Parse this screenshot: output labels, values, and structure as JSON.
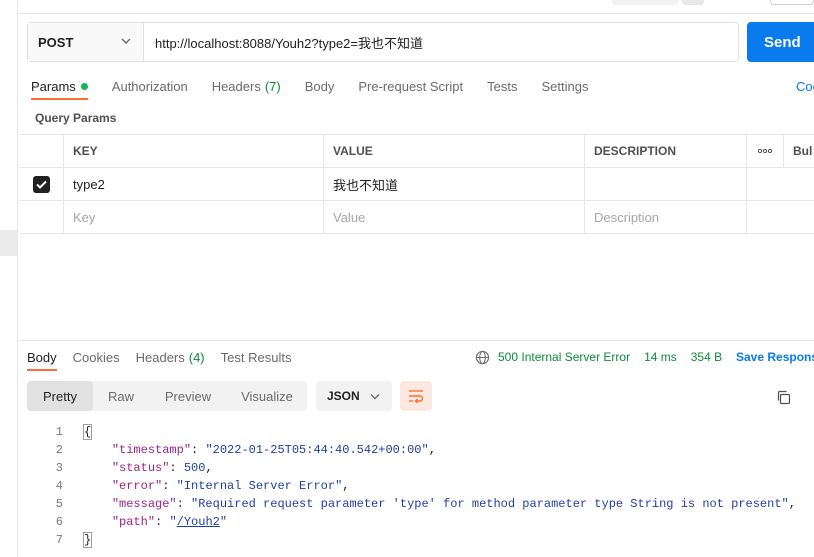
{
  "request": {
    "method": "POST",
    "url": "http://localhost:8088/Youh2?type2=我也不知道",
    "send_label": "Send"
  },
  "request_tabs": [
    {
      "label": "Params",
      "active": true,
      "dot": true
    },
    {
      "label": "Authorization"
    },
    {
      "label": "Headers",
      "count": "(7)"
    },
    {
      "label": "Body"
    },
    {
      "label": "Pre-request Script"
    },
    {
      "label": "Tests"
    },
    {
      "label": "Settings"
    }
  ],
  "cookies_label": "Coo",
  "query_params": {
    "title": "Query Params",
    "headers": [
      "KEY",
      "VALUE",
      "DESCRIPTION",
      "Bul"
    ],
    "rows": [
      {
        "checked": true,
        "key": "type2",
        "value": "我也不知道",
        "description": ""
      }
    ],
    "placeholders": {
      "key": "Key",
      "value": "Value",
      "description": "Description"
    }
  },
  "response": {
    "tabs": [
      {
        "label": "Body",
        "active": true
      },
      {
        "label": "Cookies"
      },
      {
        "label": "Headers",
        "count": "(4)"
      },
      {
        "label": "Test Results"
      }
    ],
    "status": "500 Internal Server Error",
    "time": "14 ms",
    "size": "354 B",
    "save_label": "Save Respons",
    "view_tabs": [
      "Pretty",
      "Raw",
      "Preview",
      "Visualize"
    ],
    "format": "JSON",
    "status_color": "#0f8a3e"
  },
  "code": {
    "line_numbers": [
      "1",
      "2",
      "3",
      "4",
      "5",
      "6",
      "7"
    ],
    "open_brace": "{",
    "close_brace": "}",
    "fields": [
      {
        "key": "\"timestamp\"",
        "value": "\"2022-01-25T05:44:40.542+00:00\"",
        "type": "string"
      },
      {
        "key": "\"status\"",
        "value": "500",
        "type": "number"
      },
      {
        "key": "\"error\"",
        "value": "\"Internal Server Error\"",
        "type": "string"
      },
      {
        "key": "\"message\"",
        "value": "\"Required request parameter 'type' for method parameter type String is not present\"",
        "type": "string"
      },
      {
        "key": "\"path\"",
        "value_prefix": "\"",
        "value_link": "/Youh2",
        "value_suffix": "\"",
        "type": "link"
      }
    ]
  },
  "colors": {
    "accent": "#ff6c37",
    "send": "#097bed",
    "key": "#a1218f",
    "value": "#1f3fa5"
  }
}
